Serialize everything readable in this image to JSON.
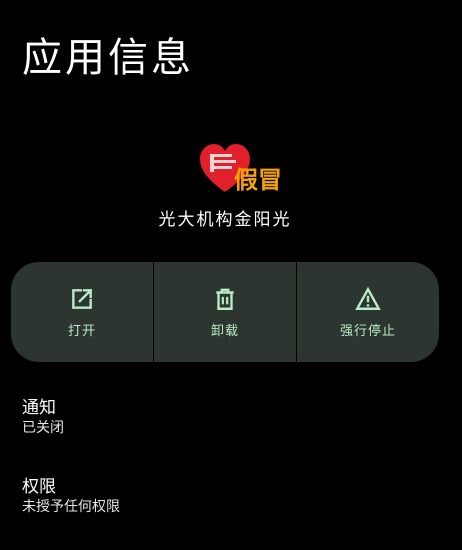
{
  "page": {
    "title": "应用信息"
  },
  "app": {
    "name": "光大机构金阳光",
    "icon_overlay_text": "假冒"
  },
  "actions": [
    {
      "label": "打开",
      "icon": "open-external-icon"
    },
    {
      "label": "卸载",
      "icon": "trash-icon"
    },
    {
      "label": "强行停止",
      "icon": "warning-icon"
    }
  ],
  "sections": {
    "notifications": {
      "title": "通知",
      "subtitle": "已关闭"
    },
    "permissions": {
      "title": "权限",
      "subtitle": "未授予任何权限"
    }
  },
  "colors": {
    "background": "#000000",
    "action_bar": "#2d3530",
    "action_accent": "#b8ecc6",
    "icon_heart": "#e0202a",
    "icon_overlay_text": "#f5a20a"
  }
}
